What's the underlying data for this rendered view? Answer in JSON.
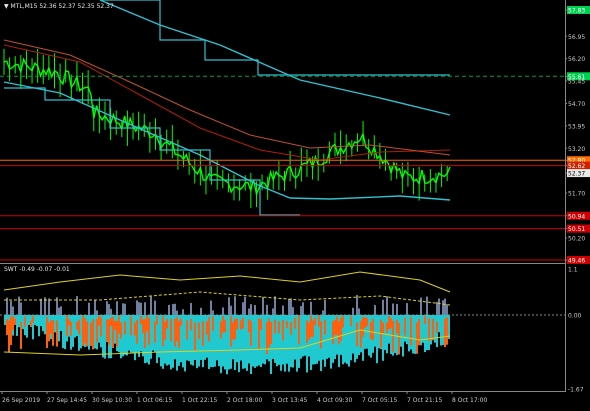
{
  "main_title": "▼ MTL,M15  52.36 52.37 52.35 52.37",
  "indicator_title": "SWT -0.49 -0.07 -0.01",
  "main_axis": {
    "labels": [
      "57.83",
      "56.95",
      "56.20",
      "55.61",
      "55.45",
      "54.70",
      "53.95",
      "53.20",
      "52.80",
      "52.62",
      "52.37",
      "51.70",
      "50.94",
      "50.51",
      "50.20",
      "49.46"
    ],
    "highlighted": [
      {
        "label": "57.83",
        "color": "#00d050"
      },
      {
        "label": "55.61",
        "color": "#00d050"
      },
      {
        "label": "52.80",
        "color": "#ff7000"
      },
      {
        "label": "52.62",
        "color": "#cc2200"
      },
      {
        "label": "52.37",
        "color": "#e8e8e8"
      },
      {
        "label": "50.94",
        "color": "#cc0000"
      },
      {
        "label": "50.51",
        "color": "#cc0000"
      },
      {
        "label": "49.46",
        "color": "#cc0000"
      }
    ]
  },
  "indicator_axis": {
    "labels": [
      "1.1",
      "0.00",
      "-1.67"
    ]
  },
  "time_axis": {
    "labels": [
      "26 Sep 2019",
      "27 Sep 14:45",
      "30 Sep 10:30",
      "1 Oct 06:15",
      "1 Oct 22:15",
      "2 Oct 18:00",
      "3 Oct 13:45",
      "4 Oct 09:30",
      "7 Oct 05:15",
      "7 Oct 21:15",
      "8 Oct 17:00"
    ]
  },
  "colors": {
    "background": "#000000",
    "candles": "#00ff00",
    "slow_ma": "#30c0d0",
    "fast_ma": "#b02000",
    "level_green": "#00a040",
    "level_orange": "#ff6600",
    "level_red": "#d00000",
    "hist_cyan": "#20c8d0",
    "hist_orange": "#ff6010",
    "hist_gray": "#7080a0",
    "env_yellow": "#e0d020"
  }
}
